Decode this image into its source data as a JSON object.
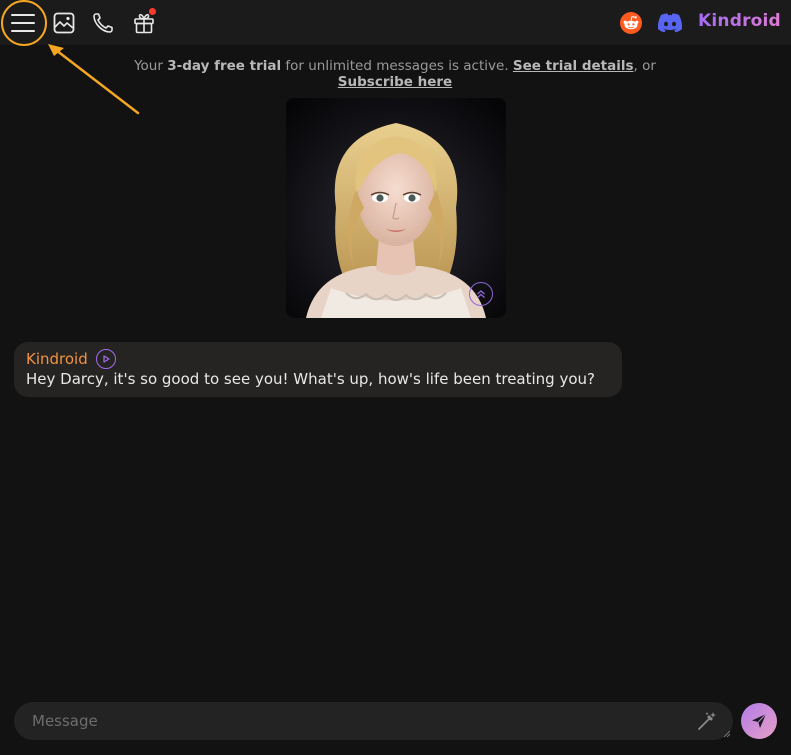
{
  "header": {
    "brand": "Kindroid",
    "icons": [
      "menu-icon",
      "gallery-icon",
      "phone-icon",
      "gift-icon",
      "reddit-icon",
      "discord-icon"
    ]
  },
  "trial_banner": {
    "prefix": "Your ",
    "highlight": "3-day free trial",
    "middle": " for unlimited messages is active. ",
    "details_link": "See trial details",
    "separator": ", or ",
    "subscribe_link": "Subscribe here"
  },
  "message": {
    "sender": "Kindroid",
    "text": "Hey Darcy, it's so good to see you! What's up, how's life been treating you?"
  },
  "composer": {
    "placeholder": "Message"
  },
  "colors": {
    "accent_orange": "#f0933f",
    "accent_purple": "#a36bf2",
    "annotation": "#f5a623",
    "background": "#121212"
  }
}
